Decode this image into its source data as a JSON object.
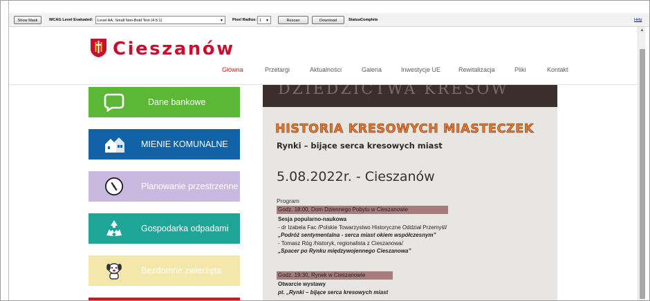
{
  "toolbar": {
    "show_mask": "Show Mask",
    "wcag_label": "WCAG Level Evaluated:",
    "wcag_value": "Level AA, Small Non-Bold Text (4.5:1)",
    "pixel_radius_label": "Pixel Radius:",
    "pixel_radius_value": "1",
    "rescan": "Rescan",
    "download": "Download",
    "status_label": "Status:",
    "status_value": "Complete",
    "help": "Help"
  },
  "site": {
    "logo_text": "Cieszanów",
    "nav": [
      "Główna",
      "Przetargi",
      "Aktualności",
      "Galeria",
      "Inwestycje UE",
      "Rewitalizacja",
      "Pliki",
      "Kontakt"
    ],
    "active_nav": "Główna"
  },
  "tiles": [
    {
      "label": "Dane bankowe",
      "icon": "chat-bubble-icon",
      "bg": "#5cb736"
    },
    {
      "label": "MIENIE KOMUNALNE",
      "icon": "buildings-icon",
      "bg": "#1262a8"
    },
    {
      "label": "Planowanie przestrzenne",
      "icon": "compass-icon",
      "bg": "#c9b9e1"
    },
    {
      "label": "Gospodarka odpadami",
      "icon": "recycle-icon",
      "bg": "#1ea597"
    },
    {
      "label": "Bezdomne zwierzęta",
      "icon": "dog-icon",
      "bg": "#f3e7ac"
    }
  ],
  "poster": {
    "top_text": "DZIEDZICTWA KRESÓW",
    "title": "HISTORIA KRESOWYCH MIASTECZEK",
    "subtitle": "Rynki – bijące serca kresowych miast",
    "date": "5.08.2022r. - Cieszanów",
    "program_label": "Program",
    "band1": "Godz. 18:00, Dom Dziennego Pobytu w Cieszanowie",
    "session": "Sesja popularno-naukowa",
    "line1": "- dr Izabela Fac /Polskie Towarzystwo Historyczne Oddział Przemyśl/",
    "line2": "„Podróż sentymentalna - serca miast okiem współczesnym”",
    "line3": "- Tomasz Róg /historyk, regionalista z Cieszanowa/",
    "line4": "„Spacer po Rynku międzywojennego Cieszanowa”",
    "band2": "Godz. 19:30, Rynek w Cieszanowie",
    "exhibit": "Otwarcie wystawy",
    "exhibit_title": "pt. „Rynki – bijące serca kresowych miast"
  },
  "colors": {
    "brand_red": "#c8102e",
    "nav_active": "#d4141e",
    "poster_orange": "#e07a2c",
    "band": "#a67c7c"
  }
}
